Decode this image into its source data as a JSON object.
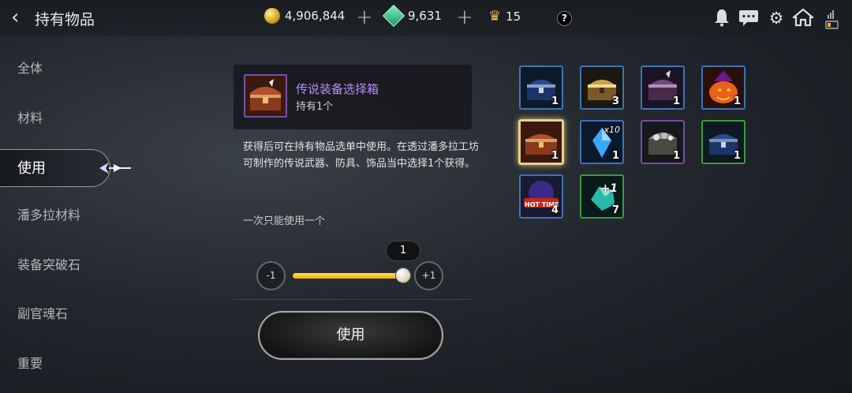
{
  "header": {
    "title": "持有物品",
    "gold": "4,906,844",
    "gems": "9,631",
    "crowns": "15",
    "help_label": "?"
  },
  "sidebar": {
    "items": [
      {
        "label": "全体"
      },
      {
        "label": "材料"
      },
      {
        "label": "使用"
      },
      {
        "label": "潘多拉材料"
      },
      {
        "label": "装备突破石"
      },
      {
        "label": "副官魂石"
      },
      {
        "label": "重要"
      }
    ],
    "active_index": 2
  },
  "detail": {
    "item_name": "传说装备选择箱",
    "owned_text": "持有1个",
    "description": "获得后可在持有物品选单中使用。在透过潘多拉工坊可制作的传说武器、防具、饰品当中选择1个获得。",
    "limit_text": "一次只能使用一个",
    "quantity": "1",
    "minus_label": "-1",
    "plus_label": "+1",
    "slider_fraction": 1.0,
    "use_button": "使用"
  },
  "inventory": [
    {
      "icon": "blue-chest-icon",
      "count": "1",
      "rarity": "blue"
    },
    {
      "icon": "gold-chest-icon",
      "count": "3",
      "rarity": "blue"
    },
    {
      "icon": "purple-chest-icon",
      "count": "1",
      "rarity": "blue"
    },
    {
      "icon": "pumpkin-icon",
      "count": "1",
      "rarity": "blue"
    },
    {
      "icon": "legendary-chest-icon",
      "count": "1",
      "rarity": "selected"
    },
    {
      "icon": "blue-crystal-icon",
      "count": "1",
      "rarity": "blue",
      "overlay": "x10"
    },
    {
      "icon": "silver-chest-icon",
      "count": "1",
      "rarity": "purple"
    },
    {
      "icon": "green-chest-icon",
      "count": "1",
      "rarity": "green"
    },
    {
      "icon": "hot-time-icon",
      "count": "4",
      "rarity": "blue",
      "overlay": "HOT TIME"
    },
    {
      "icon": "enhance-stone-icon",
      "count": "7",
      "rarity": "green",
      "overlay": "+1"
    }
  ]
}
